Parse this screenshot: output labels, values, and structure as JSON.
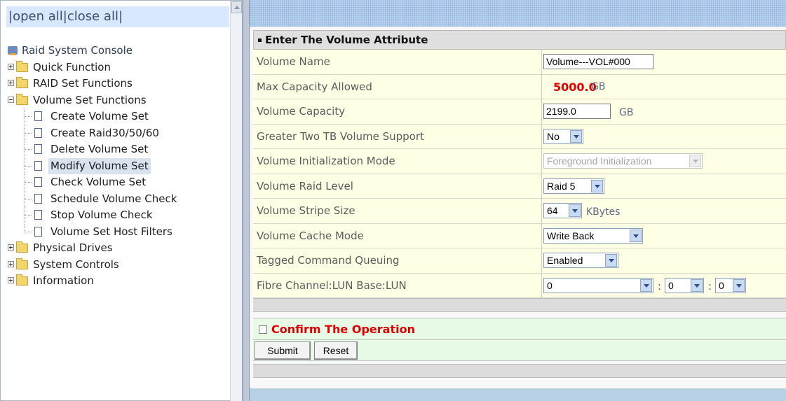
{
  "left_pane": {
    "open_close": {
      "prefix": "|",
      "open_all": "open all",
      "sep": "|",
      "close_all": "close all",
      "suffix": "|"
    },
    "tree": {
      "root": "Raid System Console",
      "items": [
        {
          "label": "Quick Function",
          "expanded": false
        },
        {
          "label": "RAID Set Functions",
          "expanded": false
        },
        {
          "label": "Volume Set Functions",
          "expanded": true
        },
        {
          "label": "Create Volume Set"
        },
        {
          "label": "Create Raid30/50/60"
        },
        {
          "label": "Delete Volume Set"
        },
        {
          "label": "Modify Volume Set",
          "selected": true
        },
        {
          "label": "Check Volume Set"
        },
        {
          "label": "Schedule Volume Check"
        },
        {
          "label": "Stop Volume Check"
        },
        {
          "label": "Volume Set Host Filters"
        },
        {
          "label": "Physical Drives",
          "expanded": false
        },
        {
          "label": "System Controls",
          "expanded": false
        },
        {
          "label": "Information",
          "expanded": false
        }
      ]
    }
  },
  "form": {
    "title": "Enter The Volume Attribute",
    "rows": [
      {
        "label": "Volume Name",
        "value": "Volume---VOL#000"
      },
      {
        "label": "Max Capacity Allowed",
        "value": "5000.0",
        "unit": "GB"
      },
      {
        "label": "Volume Capacity",
        "value": "2199.0",
        "unit": "GB"
      },
      {
        "label": "Greater Two TB Volume Support",
        "value": "No"
      },
      {
        "label": "Volume Initialization Mode",
        "value": "Foreground Initialization"
      },
      {
        "label": "Volume Raid Level",
        "value": "Raid 5"
      },
      {
        "label": "Volume Stripe Size",
        "value": "64",
        "unit": "KBytes"
      },
      {
        "label": "Volume Cache Mode",
        "value": "Write Back"
      },
      {
        "label": "Tagged Command Queuing",
        "value": "Enabled"
      },
      {
        "label": "Fibre Channel:LUN Base:LUN",
        "channel": "0",
        "lun_base": "0",
        "lun": "0",
        "separator": ":"
      }
    ],
    "confirm_label": "Confirm The Operation",
    "submit_label": "Submit",
    "reset_label": "Reset"
  },
  "colors": {
    "accent_red": "#e00000",
    "row_bg": "#ffffe6",
    "confirm_bg": "#e6fae6",
    "topbar": "#b9d3ee"
  }
}
